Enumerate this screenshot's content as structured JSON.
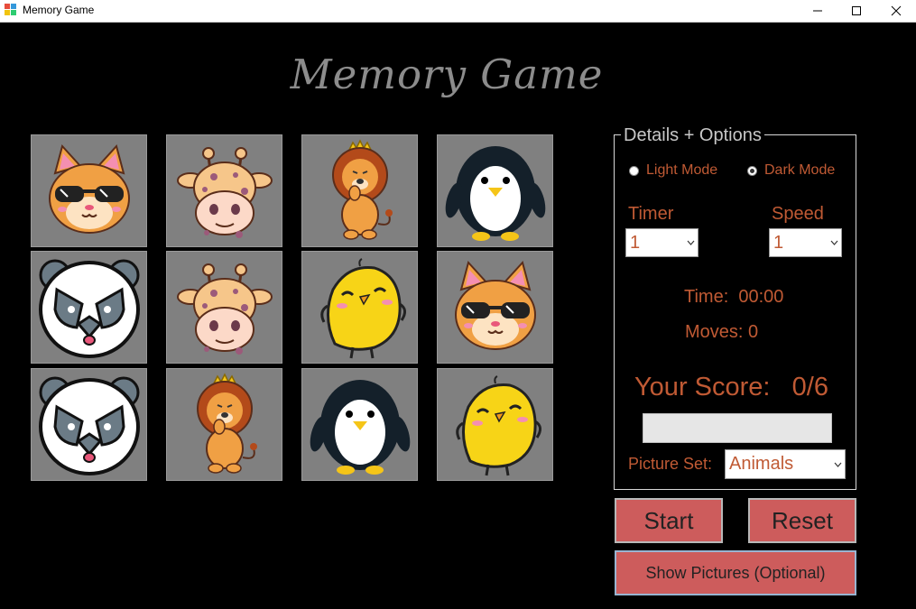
{
  "window": {
    "title": "Memory Game"
  },
  "game": {
    "title": "Memory Game"
  },
  "cards": [
    {
      "animal": "fox-with-sunglasses"
    },
    {
      "animal": "giraffe"
    },
    {
      "animal": "lion"
    },
    {
      "animal": "penguin"
    },
    {
      "animal": "panda"
    },
    {
      "animal": "giraffe"
    },
    {
      "animal": "chick"
    },
    {
      "animal": "fox-with-sunglasses"
    },
    {
      "animal": "panda"
    },
    {
      "animal": "lion"
    },
    {
      "animal": "penguin"
    },
    {
      "animal": "chick"
    }
  ],
  "options": {
    "legend": "Details + Options",
    "light_mode": "Light Mode",
    "dark_mode": "Dark Mode",
    "selected_mode": "Dark Mode",
    "timer_label": "Timer",
    "timer_value": "1",
    "speed_label": "Speed",
    "speed_value": "1",
    "time_text": "Time:  00:00",
    "moves_text": "Moves: 0",
    "score_text": "Your Score:   0/6",
    "progress_fraction": 0,
    "picture_set_label": "Picture Set:",
    "picture_set_value": "Animals"
  },
  "buttons": {
    "start": "Start",
    "reset": "Reset",
    "show_pictures": "Show Pictures (Optional)"
  },
  "colors": {
    "accent_text": "#c05a34",
    "button_bg": "#cd5c5c",
    "title_gray": "#8c8c8c"
  }
}
